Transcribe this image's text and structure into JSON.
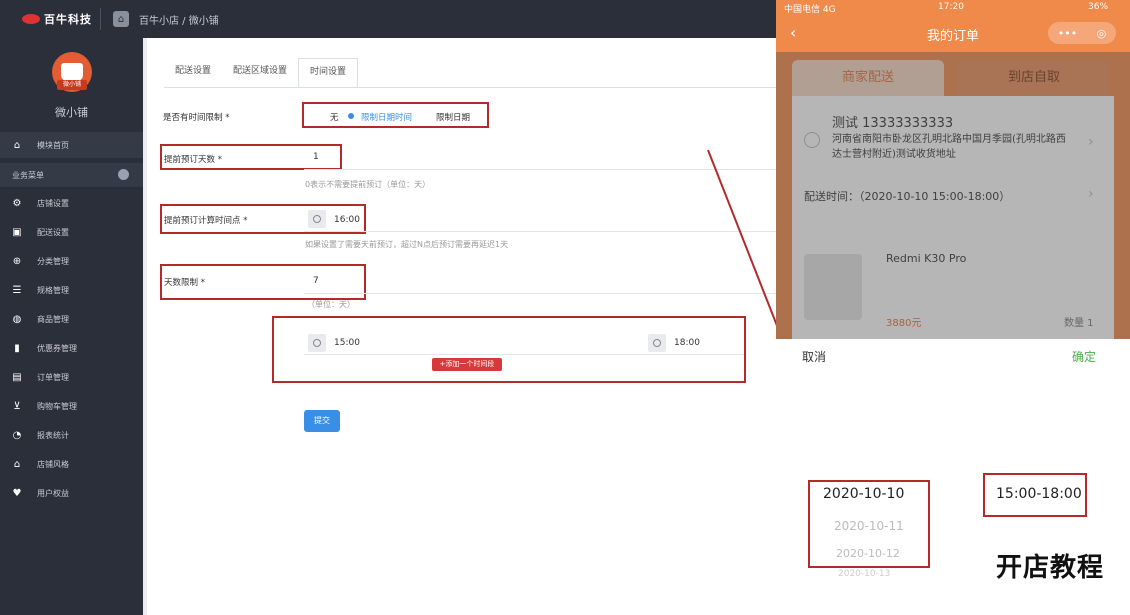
{
  "topbar": {
    "logo": "百牛科技",
    "breadcrumb": "百牛小店 / 微小铺"
  },
  "sidebar": {
    "avatar_tag": "微小铺",
    "shop_name": "微小铺",
    "home_item": "模块首页",
    "group_label": "业务菜单",
    "items": [
      {
        "label": "店铺设置",
        "icon": "gear-icon"
      },
      {
        "label": "配送设置",
        "icon": "truck-icon"
      },
      {
        "label": "分类管理",
        "icon": "grid-icon"
      },
      {
        "label": "规格管理",
        "icon": "list-icon"
      },
      {
        "label": "商品管理",
        "icon": "globe-icon"
      },
      {
        "label": "优惠券管理",
        "icon": "bookmark-icon"
      },
      {
        "label": "订单管理",
        "icon": "document-icon"
      },
      {
        "label": "购物车管理",
        "icon": "cart-icon"
      },
      {
        "label": "报表统计",
        "icon": "pie-icon"
      },
      {
        "label": "店铺风格",
        "icon": "home-icon"
      },
      {
        "label": "用户权益",
        "icon": "heart-icon"
      }
    ]
  },
  "tabs": [
    "配送设置",
    "配送区域设置",
    "时间设置"
  ],
  "form": {
    "time_limit_label": "是否有时间限制 *",
    "time_limit_options": [
      "无",
      "限制日期时间",
      "限制日期"
    ],
    "advance_days_label": "提前预订天数 *",
    "advance_days_value": "1",
    "advance_days_hint": "0表示不需要提前预订（单位：天）",
    "calc_point_label": "提前预订计算时间点 *",
    "calc_point_value": "16:00",
    "calc_point_hint": "如果设置了需要天前预订，超过N点后预订需要再延迟1天",
    "day_limit_label": "天数限制 *",
    "day_limit_value": "7",
    "day_limit_hint": "（单位：天）",
    "slot_start": "15:00",
    "slot_end": "18:00",
    "add_slot": "+添加一个时间段",
    "submit": "提交"
  },
  "phone": {
    "carrier": "中国电信  4G",
    "clock": "17:20",
    "battery": "36%",
    "title": "我的订单",
    "tab_delivery": "商家配送",
    "tab_pickup": "到店自取",
    "contact": "测试    13333333333",
    "address": "河南省南阳市卧龙区孔明北路中国月季园(孔明北路西达士营村附近)测试收货地址",
    "delivery_time": "配送时间：（2020-10-10 15:00-18:00）",
    "product_name": "Redmi K30 Pro",
    "price": "3880元",
    "quantity": "数量 1",
    "cancel": "取消",
    "confirm": "确定",
    "dates": [
      "2020-10-10",
      "2020-10-11",
      "2020-10-12",
      "2020-10-13"
    ],
    "slot": "15:00-18:00"
  },
  "caption": "开店教程"
}
